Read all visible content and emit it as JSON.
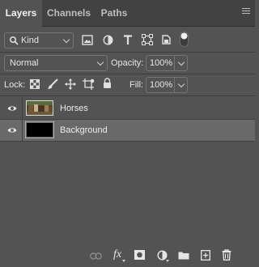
{
  "tabs": [
    {
      "label": "Layers",
      "active": true
    },
    {
      "label": "Channels",
      "active": false
    },
    {
      "label": "Paths",
      "active": false
    }
  ],
  "filter": {
    "kind_label": "Kind",
    "filter_icons": [
      "image-filter-icon",
      "adjustment-filter-icon",
      "type-filter-icon",
      "shape-filter-icon",
      "smart-object-filter-icon",
      "filter-toggle-icon"
    ]
  },
  "blend": {
    "mode": "Normal",
    "opacity_label": "Opacity:",
    "opacity_value": "100%"
  },
  "lock": {
    "label": "Lock:",
    "icons": [
      "lock-transparent-icon",
      "lock-image-icon",
      "lock-position-icon",
      "lock-artboard-icon",
      "lock-all-icon"
    ],
    "fill_label": "Fill:",
    "fill_value": "100%"
  },
  "layers": [
    {
      "name": "Horses",
      "visible": true,
      "selected": false,
      "thumbnail": "photo"
    },
    {
      "name": "Background",
      "visible": true,
      "selected": true,
      "thumbnail": "black"
    }
  ],
  "bottom_icons": [
    "link-layers-icon",
    "fx-icon",
    "add-mask-icon",
    "adjustment-layer-icon",
    "new-group-icon",
    "new-layer-icon",
    "delete-layer-icon"
  ],
  "bottom_fx_label": "fx",
  "colors": {
    "panel": "#535353",
    "tabbar": "#424242",
    "selected_row": "#696969"
  }
}
